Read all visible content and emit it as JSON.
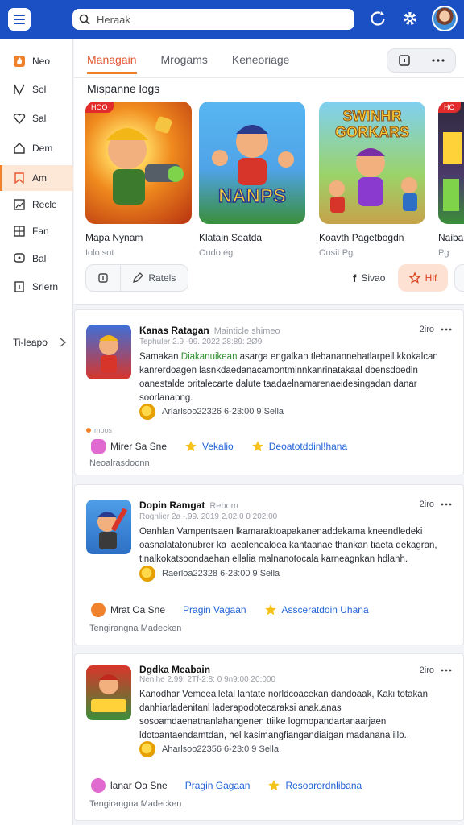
{
  "header": {
    "search_value": "Heraak",
    "colors": {
      "bar": "#1b4fc4",
      "accent": "#f0822e"
    }
  },
  "sidebar": {
    "items": [
      {
        "label": "Neo",
        "icon": "fire-icon"
      },
      {
        "label": "Sol",
        "icon": "puzzle-icon"
      },
      {
        "label": "Sal",
        "icon": "heart-icon"
      },
      {
        "label": "Dem",
        "icon": "house-icon"
      },
      {
        "label": "Am",
        "icon": "bookmark-icon",
        "active": true
      },
      {
        "label": "Recle",
        "icon": "image-icon"
      },
      {
        "label": "Fan",
        "icon": "grid-icon"
      },
      {
        "label": "Bal",
        "icon": "chat-icon"
      },
      {
        "label": "Srlern",
        "icon": "info-icon"
      }
    ],
    "more_label": "Ti-leapo"
  },
  "main": {
    "tabs": [
      {
        "label": "Managain",
        "active": true
      },
      {
        "label": "Mrogams"
      },
      {
        "label": "Keneoriage"
      }
    ],
    "section_title": "Mispanne logs",
    "games": [
      {
        "title": "Mapa Nynam",
        "sub": "Iolo sot",
        "badge": "HOO"
      },
      {
        "title": "Klatain Seatda",
        "sub": "Oudo ég",
        "thumb_text": "NANPS"
      },
      {
        "title": "Koavth Pagetbogdn",
        "sub": "Ousit Pg",
        "thumb_text": "SWINHR GORKARS"
      },
      {
        "title": "Naiba",
        "sub": "Pg",
        "badge": "HO"
      }
    ],
    "action_buttons": {
      "left_label": "Ratels",
      "right_label": "Sivao",
      "highlight_label": "Hlf"
    }
  },
  "posts": [
    {
      "title": "Kanas Ratagan",
      "tag": "Mainticle shimeo",
      "meta": "Tephuler 2.9 -99. 2022 28:89: 2Ø9",
      "time": "2iro",
      "body_lead": "Samakan ",
      "body_highlight": "Diakanuikean",
      "body_rest": " asarga engalkan tlebanannehatlarpell kkokalcan kanrerdoagen lasnkdaedanacamontminnkanrinatakaal dbensdoedin oanestalde oritalecarte dalute taadaelnamarenaeidesingadan danar soorlanapng.",
      "author": "Arlarlsoo22326 6-23:00 9 Sella",
      "small": "moos",
      "foot": [
        {
          "label": "Mirer Sa Sne",
          "icon": "chat-bubble-icon"
        },
        {
          "label": "Vekalio",
          "icon": "star-icon"
        },
        {
          "label": "Deoatotddinl!hana",
          "icon": "star-icon"
        }
      ],
      "tail": "Neoalrasdoonn"
    },
    {
      "title": "Dopin Ramgat",
      "tag": "Rebom",
      "meta": "Rognlier 2a -.99. 2019 2.02:0 0 202:00",
      "time": "2iro",
      "body_lead": "Oanhlan Vampentsaen lkamaraktoapakanenaddekama kneendledeki oasnalatatonubrer ka laealenealoea kantaanae thankan tiaeta dekagran, tinalkokatsoondaehan ellalia malnanotocala karneagnkan hdlanh.",
      "body_highlight": "",
      "body_rest": "",
      "author": "Raerloa22328 6-23:00 9 Sella",
      "small": "",
      "foot": [
        {
          "label": "Mrat Oa Sne",
          "icon": "fire-icon"
        },
        {
          "label": "Pragin Vagaan",
          "icon": "label-icon"
        },
        {
          "label": "Assceratdoin Uhana",
          "icon": "star-icon"
        }
      ],
      "tail": "Tengirangna Madecken"
    },
    {
      "title": "Dgdka Meabain",
      "tag": "",
      "meta": "Nenihe 2.99. 2Tf-2:8: 0 9n9:00 20:000",
      "time": "2iro",
      "body_lead": "Kanodhar Vemeeailetal lantate norldcoacekan dandoaak, Kaki totakan danhiarladenitanl laderapodotecaraksi anak.anas sosoamdaenatnanlahangenen ttiike logmopandartanaarjaen ldotoantaendamtdan, hel kasimangfiangandiaigan madanana illo..",
      "body_highlight": "",
      "body_rest": "",
      "author": "Aharlsoo22356 6-23:0 9 Sella",
      "small": "",
      "foot": [
        {
          "label": "lanar Oa Sne",
          "icon": "chat-bubble-icon"
        },
        {
          "label": "Pragin Gagaan",
          "icon": "label-icon"
        },
        {
          "label": "Resoarordnlibana",
          "icon": "star-icon"
        }
      ],
      "tail": "Tengirangna Madecken"
    }
  ]
}
